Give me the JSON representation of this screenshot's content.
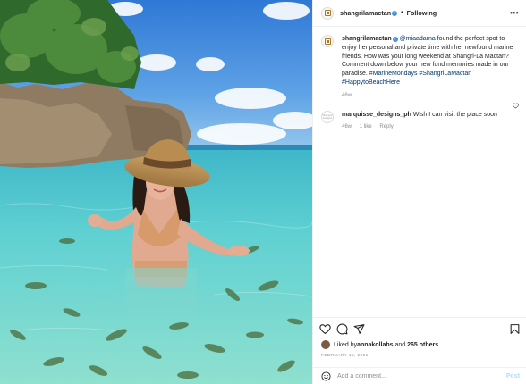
{
  "photo": {
    "alt_icon": "beach-photo"
  },
  "header": {
    "username": "shangrilamactan",
    "separator": "•",
    "follow_label": "Following",
    "more_label": "•••"
  },
  "caption": {
    "username": "shangrilamactan",
    "mention": "@miaadarna",
    "text": " found the perfect spot to enjoy her personal and private time with her newfound marine friends. How was your long weekend at Shangri-La Mactan? Comment down below your new fond memories made in our paradise.",
    "hashtags": "#MarineMondays #ShangriLaMactan #HappytoBeachHere",
    "age": "46w"
  },
  "comment": {
    "username": "marquisse_designs_ph",
    "text": " Wish I can visit the place soon",
    "age": "46w",
    "likes": "1 like",
    "reply_label": "Reply",
    "avatar_text": "Marquis Designs"
  },
  "likes": {
    "prefix": "Liked by ",
    "user": "annakollabs",
    "and": " and ",
    "others": "265 others"
  },
  "date": "FEBRUARY 15, 2021",
  "add_comment": {
    "placeholder": "Add a comment...",
    "post_label": "Post"
  },
  "colors": {
    "link": "#00376b",
    "verified": "#3897f0",
    "post_disabled": "#b3dbff"
  }
}
